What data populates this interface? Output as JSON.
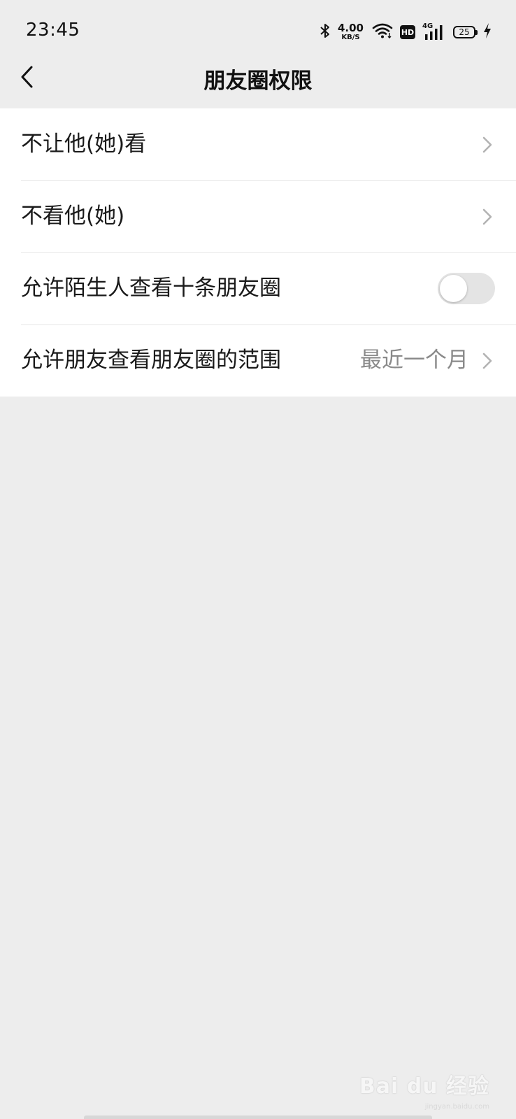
{
  "status_bar": {
    "time": "23:45",
    "net_speed_value": "4.00",
    "net_speed_unit": "KB/S",
    "hd_badge": "HD",
    "network_type": "4G",
    "battery_level": "25",
    "icons": [
      "bluetooth-icon",
      "wifi-icon",
      "hd-icon",
      "signal-icon",
      "battery-icon",
      "charging-icon"
    ]
  },
  "header": {
    "title": "朋友圈权限",
    "back_icon": "chevron-left-icon"
  },
  "settings": {
    "items": [
      {
        "label": "不让他(她)看",
        "control": "chevron"
      },
      {
        "label": "不看他(她)",
        "control": "chevron"
      },
      {
        "label": "允许陌生人查看十条朋友圈",
        "control": "toggle",
        "toggle_on": false
      },
      {
        "label": "允许朋友查看朋友圈的范围",
        "value": "最近一个月",
        "control": "chevron"
      }
    ]
  },
  "watermark": {
    "text": "Bai du 经验",
    "subtext": "jingyan.baidu.com"
  },
  "colors": {
    "background": "#ededed",
    "card": "#ffffff",
    "text": "#1a1a1a",
    "secondary_text": "#8a8a8a",
    "toggle_off": "#e4e4e4"
  }
}
